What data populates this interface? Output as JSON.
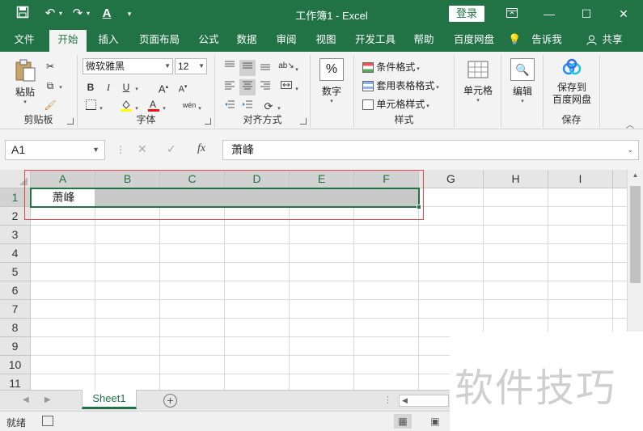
{
  "titlebar": {
    "title": "工作簿1  -  Excel",
    "login": "登录",
    "icons": [
      "save-icon",
      "undo-icon",
      "redo-icon",
      "font-color-quick-icon",
      "customize-icon"
    ],
    "window_controls": [
      "ribbon-display-icon",
      "minimize-icon",
      "maximize-icon",
      "close-icon"
    ]
  },
  "tabs": [
    {
      "label": "文件"
    },
    {
      "label": "开始",
      "active": true
    },
    {
      "label": "插入"
    },
    {
      "label": "页面布局"
    },
    {
      "label": "公式"
    },
    {
      "label": "数据"
    },
    {
      "label": "审阅"
    },
    {
      "label": "视图"
    },
    {
      "label": "开发工具"
    },
    {
      "label": "帮助"
    },
    {
      "label": "百度网盘"
    },
    {
      "label": "告诉我"
    },
    {
      "label": "共享"
    }
  ],
  "ribbon": {
    "clipboard": {
      "label": "剪贴板",
      "paste": "粘贴"
    },
    "font": {
      "label": "字体",
      "font_name": "微软雅黑",
      "font_size": "12",
      "bold": "B",
      "italic": "I",
      "underline": "U",
      "grow": "A",
      "shrink": "A",
      "phonetic": "wén"
    },
    "alignment": {
      "label": "对齐方式"
    },
    "number": {
      "label": "数字",
      "symbol": "%"
    },
    "styles": {
      "label": "样式",
      "conditional": "条件格式",
      "table": "套用表格格式",
      "cell": "单元格样式"
    },
    "cells": {
      "label": "单元格"
    },
    "editing": {
      "label": "编辑"
    },
    "save": {
      "label": "保存",
      "button": "保存到",
      "button2": "百度网盘"
    }
  },
  "formula_bar": {
    "name_box": "A1",
    "fx": "fx",
    "content": "萧峰"
  },
  "grid": {
    "columns": [
      "A",
      "B",
      "C",
      "D",
      "E",
      "F",
      "G",
      "H",
      "I"
    ],
    "rows": [
      "1",
      "2",
      "3",
      "4",
      "5",
      "6",
      "7",
      "8",
      "9",
      "10",
      "11"
    ],
    "selected_range": "A1:F1",
    "cells": {
      "A1": "萧峰"
    }
  },
  "sheets": {
    "tabs": [
      "Sheet1"
    ],
    "active": "Sheet1",
    "add": "+"
  },
  "status": {
    "text": "就绪"
  },
  "watermark": "软件技巧",
  "colors": {
    "accent": "#217346",
    "selection": "#c8c8c8",
    "highlight_box": "#e24a4a"
  }
}
